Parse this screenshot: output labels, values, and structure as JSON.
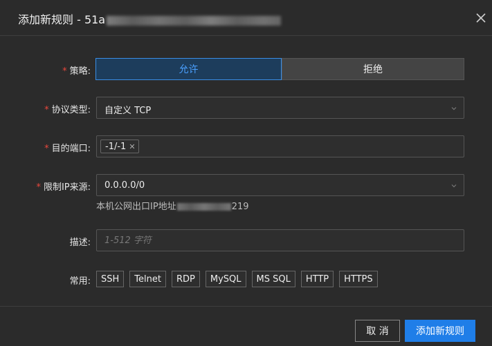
{
  "dialog": {
    "title": "添加新规则 - 51a",
    "close_icon": "close-icon"
  },
  "form": {
    "policy": {
      "label": "策略:",
      "options": [
        "允许",
        "拒绝"
      ],
      "selected": "允许"
    },
    "protocol": {
      "label": "协议类型:",
      "value": "自定义 TCP",
      "icon": "chevron-down-icon"
    },
    "port": {
      "label": "目的端口:",
      "tags": [
        "-1/-1"
      ]
    },
    "source_ip": {
      "label": "限制IP来源:",
      "value": "0.0.0.0/0",
      "hint_prefix": "本机公网出口IP地址",
      "hint_suffix": "219"
    },
    "description": {
      "label": "描述:",
      "placeholder": "1-512 字符"
    },
    "common": {
      "label": "常用:",
      "items": [
        "SSH",
        "Telnet",
        "RDP",
        "MySQL",
        "MS SQL",
        "HTTP",
        "HTTPS"
      ]
    }
  },
  "footer": {
    "cancel_label": "取 消",
    "submit_label": "添加新规则"
  },
  "colors": {
    "accent": "#1f7ee8",
    "required": "#e8473c",
    "background": "#2b2b2b"
  }
}
